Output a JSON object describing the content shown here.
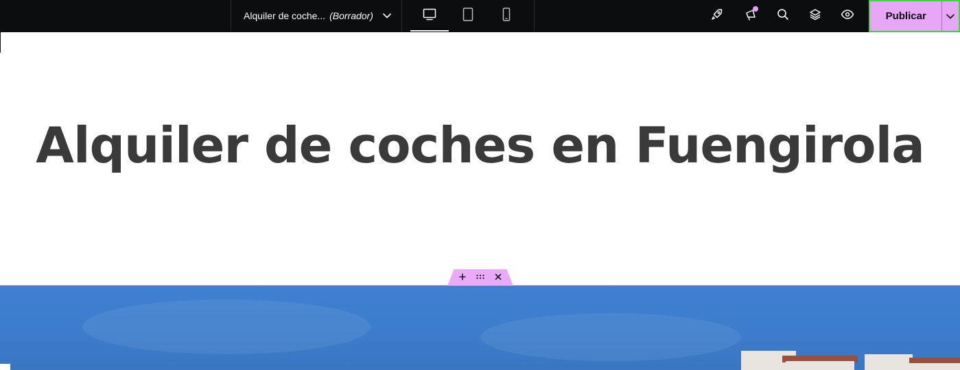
{
  "header": {
    "doc_title": "Alquiler de coche...",
    "doc_status": "(Borrador)",
    "devices": [
      {
        "name": "desktop",
        "active": true
      },
      {
        "name": "tablet",
        "active": false
      },
      {
        "name": "mobile",
        "active": false
      }
    ],
    "tools": [
      "rocket-icon",
      "announcements-icon",
      "search-icon",
      "layers-icon",
      "preview-icon"
    ],
    "publish_label": "Publicar",
    "accent_color": "#e7a6f6"
  },
  "canvas": {
    "heading": "Alquiler de coches en Fuengirola"
  }
}
